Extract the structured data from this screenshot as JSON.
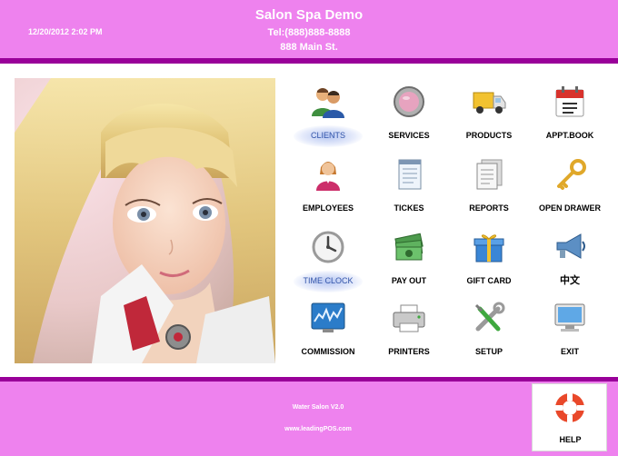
{
  "header": {
    "datetime": "12/20/2012 2:02 PM",
    "store_name": "Salon Spa Demo",
    "phone": "Tel:(888)888-8888",
    "address": "888 Main St."
  },
  "menu": [
    {
      "label": "CLIENTS",
      "icon": "clients-icon",
      "selected": true
    },
    {
      "label": "SERVICES",
      "icon": "compact-mirror-icon"
    },
    {
      "label": "PRODUCTS",
      "icon": "delivery-truck-icon"
    },
    {
      "label": "APPT.BOOK",
      "icon": "calendar-icon"
    },
    {
      "label": "EMPLOYEES",
      "icon": "employee-icon"
    },
    {
      "label": "TICKES",
      "icon": "notepad-icon"
    },
    {
      "label": "REPORTS",
      "icon": "report-document-icon"
    },
    {
      "label": "OPEN DRAWER",
      "icon": "key-icon"
    },
    {
      "label": "TIME CLOCK",
      "icon": "clock-icon",
      "selected": true
    },
    {
      "label": "PAY OUT",
      "icon": "money-icon"
    },
    {
      "label": "GIFT CARD",
      "icon": "gift-box-icon"
    },
    {
      "label": "中文",
      "icon": "megaphone-icon"
    },
    {
      "label": "COMMISSION",
      "icon": "chart-monitor-icon"
    },
    {
      "label": "PRINTERS",
      "icon": "printer-icon"
    },
    {
      "label": "SETUP",
      "icon": "tools-icon"
    },
    {
      "label": "EXIT",
      "icon": "computer-icon"
    }
  ],
  "footer": {
    "version": "Water Salon V2.0",
    "website": "www.leadingPOS.com",
    "help_label": "HELP",
    "help_icon": "lifebuoy-icon"
  },
  "colors": {
    "header_bg": "#ee82ee",
    "divider": "#990099",
    "selected_label": "#3355aa"
  }
}
